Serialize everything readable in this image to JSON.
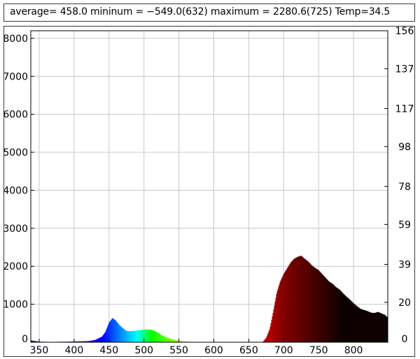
{
  "status": {
    "text": "average= 458.0 mininum = −549.0(632) maximum = 2280.6(725) Temp=34.5"
  },
  "chart_data": {
    "type": "area",
    "title": "",
    "xlabel": "",
    "ylabel": "",
    "xlim": [
      338,
      849
    ],
    "ylim": [
      0,
      8200
    ],
    "y2lim": [
      0,
      156
    ],
    "grid": true,
    "x_ticks": [
      350,
      400,
      450,
      500,
      550,
      600,
      650,
      700,
      750,
      800
    ],
    "y_ticks": [
      0,
      1000,
      2000,
      3000,
      4000,
      5000,
      6000,
      7000,
      8000
    ],
    "y2_ticks": [
      0,
      20,
      39,
      59,
      78,
      98,
      117,
      137,
      156
    ],
    "coloring": "wavelength spectrum",
    "series": [
      {
        "x": [
          338,
          350,
          360,
          370,
          380,
          390,
          400,
          410,
          420,
          430,
          440,
          445,
          450,
          455,
          460,
          465,
          470,
          475,
          480,
          485,
          490,
          495,
          500,
          505,
          510,
          515,
          520,
          525,
          530,
          535,
          540,
          545,
          550,
          560,
          570,
          580,
          600,
          620,
          640,
          660,
          670,
          675,
          680,
          685,
          690,
          695,
          700,
          705,
          710,
          715,
          720,
          725,
          730,
          735,
          740,
          745,
          750,
          755,
          760,
          765,
          770,
          775,
          780,
          785,
          790,
          795,
          800,
          805,
          810,
          815,
          820,
          825,
          830,
          835,
          840,
          845,
          849
        ],
        "values": [
          50,
          15,
          10,
          8,
          12,
          15,
          20,
          25,
          30,
          60,
          150,
          280,
          520,
          640,
          570,
          450,
          370,
          300,
          290,
          300,
          310,
          320,
          330,
          335,
          330,
          300,
          250,
          190,
          140,
          110,
          80,
          60,
          40,
          20,
          10,
          5,
          0,
          0,
          0,
          0,
          10,
          120,
          350,
          800,
          1300,
          1600,
          1800,
          1950,
          2100,
          2200,
          2250,
          2280,
          2200,
          2130,
          2030,
          1960,
          1900,
          1800,
          1700,
          1600,
          1540,
          1450,
          1390,
          1290,
          1200,
          1120,
          1030,
          950,
          880,
          850,
          820,
          780,
          770,
          800,
          760,
          720,
          650
        ]
      }
    ]
  }
}
